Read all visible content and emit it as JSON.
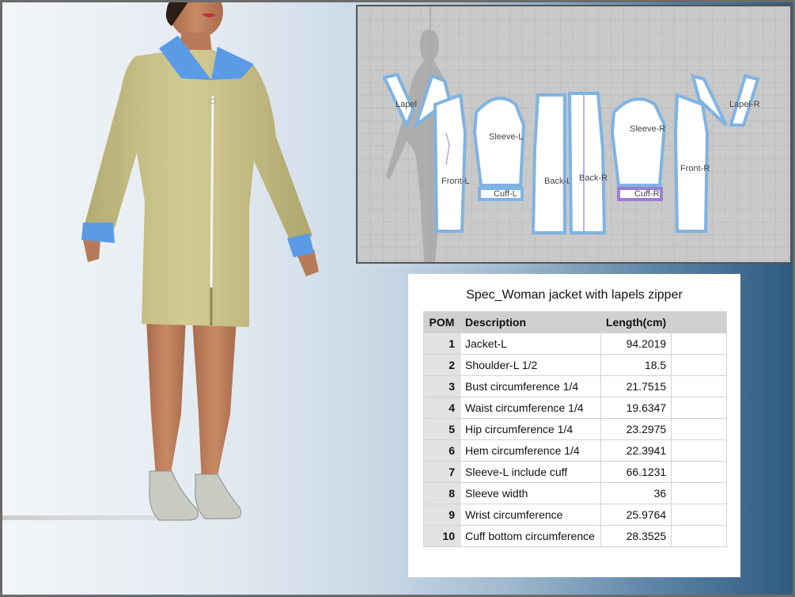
{
  "pattern_pieces": {
    "lapel_l": "Lapel",
    "lapel_r": "Lapel-R",
    "sleeve_l": "Sleeve-L",
    "sleeve_r": "Sleeve-R",
    "front_l": "Front-L",
    "front_r": "Front-R",
    "back_l": "Back-L",
    "back_r": "Back-R",
    "cuff_l": "Cuff-L",
    "cuff_r": "Cuff-R"
  },
  "colors": {
    "coat": "#c9c28a",
    "collar": "#5b9be6",
    "piece_fill": "#ffffff",
    "piece_outline": "#7fb3e3"
  },
  "spec": {
    "title": "Spec_Woman jacket with lapels zipper",
    "columns": [
      "POM",
      "Description",
      "Length(cm)",
      ""
    ],
    "rows": [
      {
        "pom": "1",
        "description": "Jacket-L",
        "length": "94.2019"
      },
      {
        "pom": "2",
        "description": "Shoulder-L 1/2",
        "length": "18.5"
      },
      {
        "pom": "3",
        "description": "Bust circumference 1/4",
        "length": "21.7515"
      },
      {
        "pom": "4",
        "description": "Waist circumference 1/4",
        "length": "19.6347"
      },
      {
        "pom": "5",
        "description": "Hip circumference 1/4",
        "length": "23.2975"
      },
      {
        "pom": "6",
        "description": "Hem circumference 1/4",
        "length": "22.3941"
      },
      {
        "pom": "7",
        "description": "Sleeve-L include cuff",
        "length": "66.1231"
      },
      {
        "pom": "8",
        "description": "Sleeve width",
        "length": "36"
      },
      {
        "pom": "9",
        "description": "Wrist circumference",
        "length": "25.9764"
      },
      {
        "pom": "10",
        "description": "Cuff bottom circumference",
        "length": "28.3525"
      }
    ]
  }
}
